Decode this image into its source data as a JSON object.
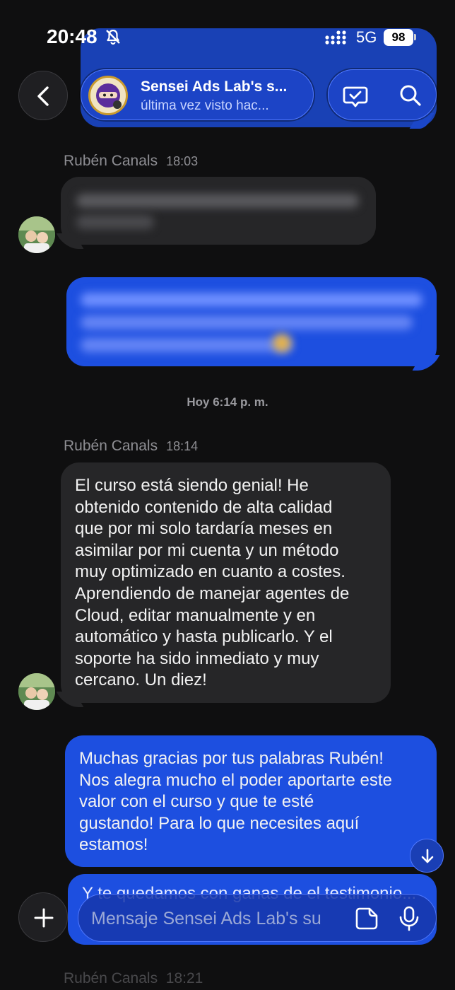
{
  "status_bar": {
    "time": "20:48",
    "network": "5G",
    "battery": "98",
    "icons": [
      "bell-slash-icon",
      "signal-icon"
    ]
  },
  "header": {
    "title": "Sensei Ads Lab's s...",
    "subtitle": "última vez visto hac...",
    "back_icon": "chevron-left-icon",
    "actions": [
      "check-message-icon",
      "search-icon"
    ]
  },
  "messages": [
    {
      "id": "m1",
      "direction": "incoming",
      "sender": "Rubén Canals",
      "time": "18:03",
      "text": "",
      "redacted": true
    },
    {
      "id": "m2",
      "direction": "outgoing",
      "text": "",
      "redacted": true
    },
    {
      "id": "sep",
      "type": "date_separator",
      "text": "Hoy 6:14 p. m."
    },
    {
      "id": "m3",
      "direction": "incoming",
      "sender": "Rubén Canals",
      "time": "18:14",
      "lines": [
        "El curso está siendo genial! He",
        "obtenido contenido de alta calidad",
        "que por mi solo tardaría meses en",
        "asimilar por mi cuenta y un método",
        "muy optimizado en cuanto a costes.",
        "Aprendiendo de manejar agentes de",
        "Cloud, editar manualmente y en",
        "automático y hasta publicarlo. Y el",
        "soporte ha sido inmediato y muy",
        "cercano. Un diez!"
      ]
    },
    {
      "id": "m4",
      "direction": "outgoing",
      "lines": [
        "Muchas gracias por tus palabras Rubén!",
        "Nos alegra mucho el poder aportarte este",
        "valor con el curso y que te esté",
        "gustando! Para lo que necesites aquí",
        "estamos!"
      ]
    },
    {
      "id": "m5",
      "direction": "outgoing",
      "partial_text": "Y te quedamos con ganas de el testimonio..."
    }
  ],
  "next_sender": {
    "name": "Rubén Canals",
    "time": "18:21"
  },
  "composer": {
    "placeholder": "Mensaje Sensei Ads Lab's su",
    "plus_icon": "plus-icon",
    "sticker_icon": "sticker-icon",
    "mic_icon": "microphone-icon"
  },
  "scroll_down_icon": "arrow-down-icon",
  "colors": {
    "background": "#0f0f10",
    "incoming_bubble": "#262628",
    "outgoing_bubble": "#1d4fe0",
    "header_pill": "#1c44c8"
  }
}
